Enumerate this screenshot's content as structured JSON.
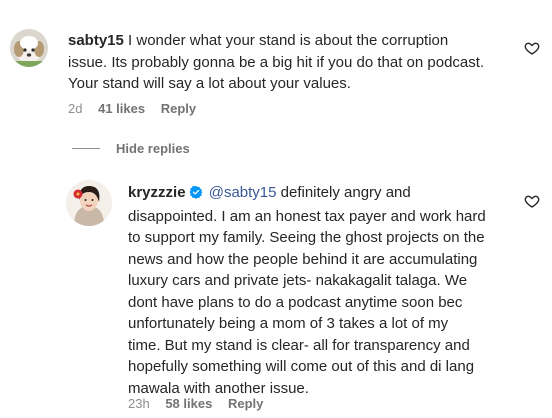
{
  "comments": [
    {
      "username": "sabty15",
      "text": "I wonder what your stand is about the corruption issue. Its probably gonna be a big hit if you do that on podcast. Your stand will say a lot about your values.",
      "lines": [
        "I wonder what your stand is about the corruption",
        "issue. Its probably gonna be a big hit if you do that on podcast.",
        "Your stand will say a lot about your values."
      ],
      "time": "2d",
      "likes": "41 likes",
      "reply_label": "Reply",
      "avatar_icon": "dog-avatar"
    }
  ],
  "replies_toggle": {
    "label": "Hide replies"
  },
  "replies": [
    {
      "username": "kryzzzie",
      "verified": true,
      "mention": "@sabty15",
      "lines": [
        "definitely angry and",
        "disappointed. I am an honest tax payer and work hard",
        "to support my family. Seeing the ghost projects on the",
        "news and how the people behind it are accumulating",
        "luxury cars and private jets- nakakagalit talaga. We",
        "dont have plans to do a podcast anytime soon bec",
        "unfortunately being a mom of 3 takes a lot of my",
        "time. But my stand is clear- all for transparency and",
        "hopefully something will come out of this and di lang",
        "mawala with another issue."
      ],
      "time": "23h",
      "likes": "58 likes",
      "reply_label": "Reply",
      "avatar_icon": "woman-with-flower-avatar"
    }
  ],
  "colors": {
    "text": "#262626",
    "secondary": "#8e8e8e",
    "mention": "#385898",
    "verified": "#0095f6"
  }
}
